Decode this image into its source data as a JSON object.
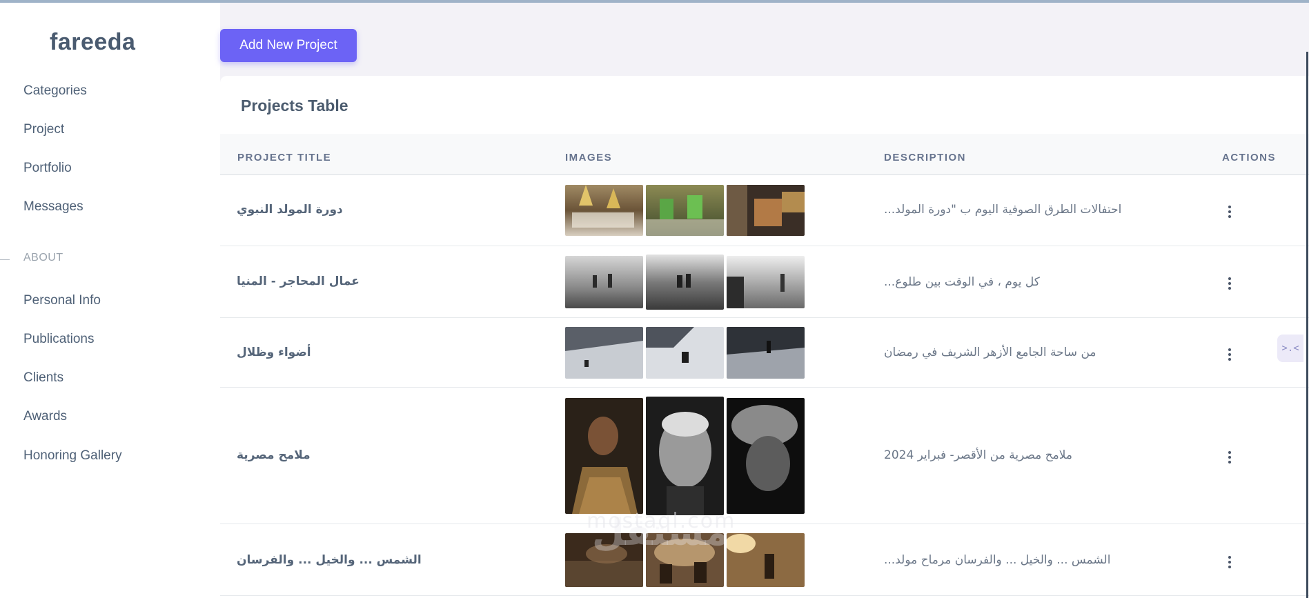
{
  "brand": "fareeda",
  "sidebar": {
    "items": [
      "Categories",
      "Project",
      "Portfolio",
      "Messages"
    ],
    "section_label": "ABOUT",
    "about_items": [
      "Personal Info",
      "Publications",
      "Clients",
      "Awards",
      "Honoring Gallery"
    ]
  },
  "toolbar": {
    "add_label": "Add New Project"
  },
  "table": {
    "title": "Projects Table",
    "headers": [
      "PROJECT TITLE",
      "IMAGES",
      "DESCRIPTION",
      "ACTIONS"
    ],
    "rows": [
      {
        "title": "دورة المولد النبوي",
        "description": "احتفالات الطرق الصوفية اليوم ب \"دورة المولد...",
        "image_tones": [
          "festival-crowd-warm",
          "festival-green-flags",
          "market-scene-warm"
        ]
      },
      {
        "title": "عمال المحاجر - المنيا",
        "description": "كل يوم ، في الوقت بين طلوع...",
        "image_tones": [
          "quarry-mist-bw",
          "quarry-workers-bw",
          "quarry-figure-bw"
        ]
      },
      {
        "title": "أضواء وظلال",
        "description": "من ساحة الجامع الأزهر الشريف في رمضان",
        "image_tones": [
          "courtyard-shadows",
          "courtyard-figure",
          "courtyard-dark"
        ]
      },
      {
        "title": "ملامح مصرية",
        "description": "ملامح مصرية من الأقصر- فبراير 2024",
        "image_tones": [
          "portrait-boy",
          "portrait-old-man",
          "portrait-turban-bw"
        ]
      },
      {
        "title": "الشمس ... والخيل ... والفرسان",
        "description": "الشمس ... والخيل ... والفرسان مرماح مولد...",
        "image_tones": [
          "horses-dust-dark",
          "horses-dust-sepia",
          "horseman-sunlight"
        ]
      }
    ]
  },
  "icons": {
    "row_action": "kebab-menu-icon",
    "float_button": "code-icon"
  },
  "float_button_label": ">.<",
  "watermark": {
    "latin": "mostaql.com",
    "arabic": "مستقل"
  },
  "colors": {
    "accent": "#6c63f5",
    "sidebar_bg": "#ffffff",
    "page_bg": "#f3f2f7"
  }
}
